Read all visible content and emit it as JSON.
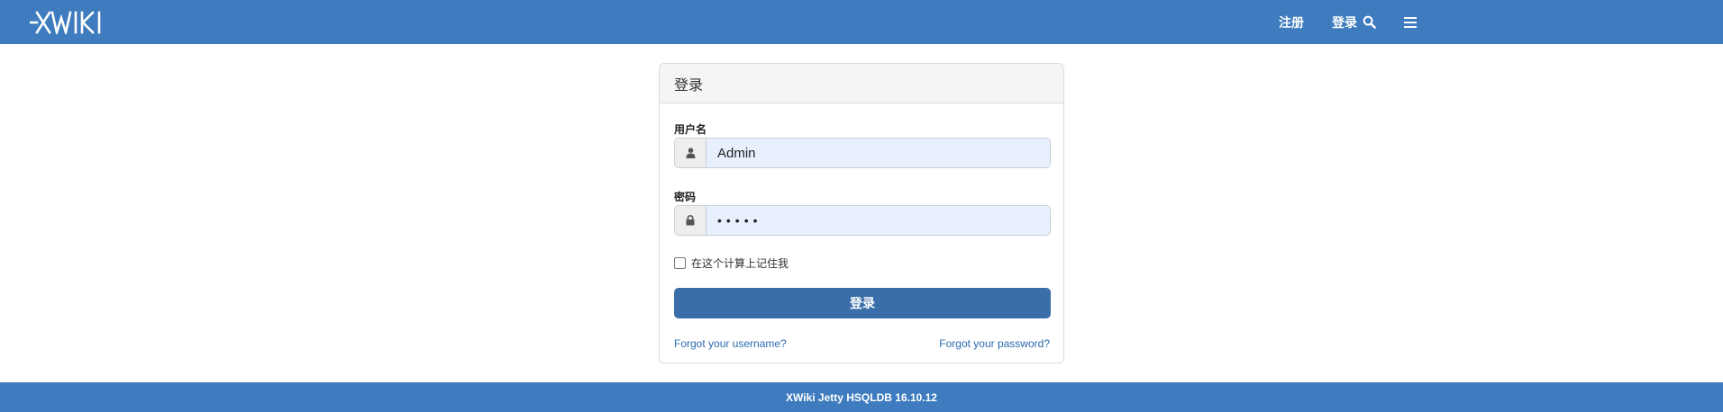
{
  "header": {
    "logo_text": "XWIKI",
    "register_label": "注册",
    "login_label": "登录",
    "search_icon": "search-icon",
    "menu_icon": "hamburger-menu-icon"
  },
  "login_panel": {
    "title": "登录",
    "username": {
      "label": "用户名",
      "value": "Admin",
      "icon": "user-icon"
    },
    "password": {
      "label": "密码",
      "value": "•••••",
      "icon": "lock-icon"
    },
    "remember_me": {
      "label": "在这个计算上记住我",
      "checked": false
    },
    "submit_label": "登录",
    "forgot_username": "Forgot your username?",
    "forgot_password": "Forgot your password?"
  },
  "footer": {
    "text": "XWiki Jetty HSQLDB 16.10.12"
  },
  "colors": {
    "brand_blue": "#3e7cbf",
    "button_blue": "#3a6ea8",
    "link_blue": "#2a6bb0",
    "input_autofill": "#e8f0fe"
  }
}
